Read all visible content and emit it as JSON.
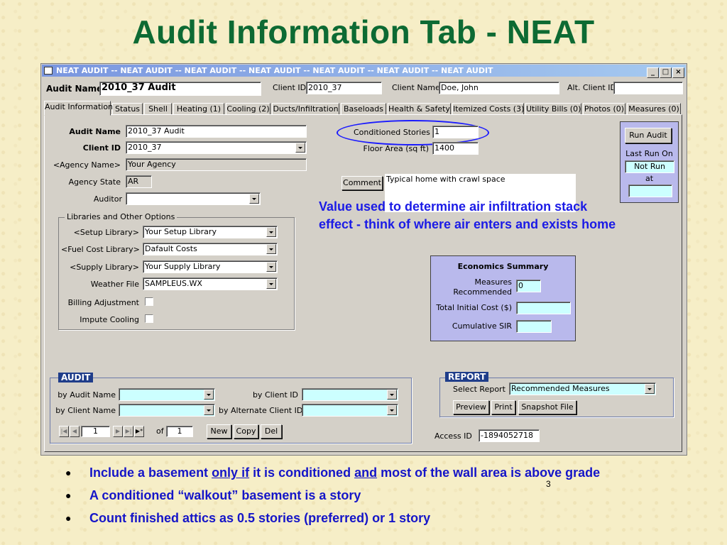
{
  "slide": {
    "title": "Audit Information Tab - NEAT",
    "page_number": "3",
    "callout": "Value used to determine air infiltration stack effect - think of where air enters and exists home",
    "bullets": [
      {
        "pre": "Include a basement ",
        "u1": "only if",
        "mid": " it is conditioned ",
        "u2": "and",
        "post": " most of the wall area is above grade"
      },
      {
        "text": "A conditioned “walkout” basement is a story"
      },
      {
        "text": "Count finished attics as 0.5 stories (preferred) or 1 story"
      }
    ]
  },
  "window": {
    "title": "NEAT AUDIT  --  NEAT AUDIT  --  NEAT AUDIT  --  NEAT AUDIT  --  NEAT AUDIT  --  NEAT AUDIT  --  NEAT AUDIT",
    "controls": {
      "minimize": "_",
      "maximize": "□",
      "close": "×"
    }
  },
  "header": {
    "audit_name_label": "Audit Name",
    "audit_name_value": "2010_37 Audit",
    "client_id_label": "Client ID",
    "client_id_value": "2010_37",
    "client_name_label": "Client Name",
    "client_name_value": "Doe, John",
    "alt_client_id_label": "Alt. Client ID",
    "alt_client_id_value": ""
  },
  "tabs": [
    "Audit Information",
    "Status",
    "Shell",
    "Heating (1)",
    "Cooling (2)",
    "Ducts/Infiltration",
    "Baseloads",
    "Health & Safety",
    "Itemized Costs (3)",
    "Utility Bills (0)",
    "Photos (0)",
    "Measures (0)"
  ],
  "form": {
    "audit_name_label": "Audit Name",
    "audit_name_value": "2010_37 Audit",
    "client_id_label": "Client ID",
    "client_id_value": "2010_37",
    "agency_name_label": "<Agency Name>",
    "agency_name_value": "Your Agency",
    "agency_state_label": "Agency State",
    "agency_state_value": "AR",
    "auditor_label": "Auditor",
    "auditor_value": "",
    "conditioned_stories_label": "Conditioned Stories",
    "conditioned_stories_value": "1",
    "floor_area_label": "Floor Area (sq ft)",
    "floor_area_value": "1400",
    "comment_button": "Comment",
    "comment_value": "Typical home with crawl space"
  },
  "libraries": {
    "title": "Libraries and Other Options",
    "setup_label": "<Setup Library>",
    "setup_value": "Your Setup Library",
    "fuel_label": "<Fuel Cost Library>",
    "fuel_value": "Dafault Costs",
    "supply_label": "<Supply Library>",
    "supply_value": "Your Supply Library",
    "weather_label": "Weather File",
    "weather_value": "SAMPLEUS.WX",
    "billing_label": "Billing Adjustment",
    "impute_label": "Impute Cooling"
  },
  "run": {
    "run_button": "Run Audit",
    "last_run_label": "Last Run On",
    "last_run_value": "Not Run",
    "at_label": "at",
    "at_value": ""
  },
  "economics": {
    "title": "Economics Summary",
    "measures_label_1": "Measures",
    "measures_label_2": "Recommended",
    "measures_value": "0",
    "total_cost_label": "Total Initial Cost ($)",
    "total_cost_value": "",
    "sir_label": "Cumulative SIR",
    "sir_value": ""
  },
  "audit_box": {
    "title": "AUDIT",
    "by_audit_name_label": "by Audit Name",
    "by_client_id_label": "by Client ID",
    "by_client_name_label": "by Client Name",
    "by_alt_client_id_label": "by Alternate Client ID",
    "record_current": "1",
    "of_label": "of",
    "record_total": "1",
    "new_button": "New",
    "copy_button": "Copy",
    "del_button": "Del"
  },
  "report_box": {
    "title": "REPORT",
    "select_label": "Select Report",
    "select_value": "Recommended Measures",
    "preview_button": "Preview",
    "print_button": "Print",
    "snapshot_button": "Snapshot File",
    "access_id_label": "Access ID",
    "access_id_value": "-1894052718"
  }
}
